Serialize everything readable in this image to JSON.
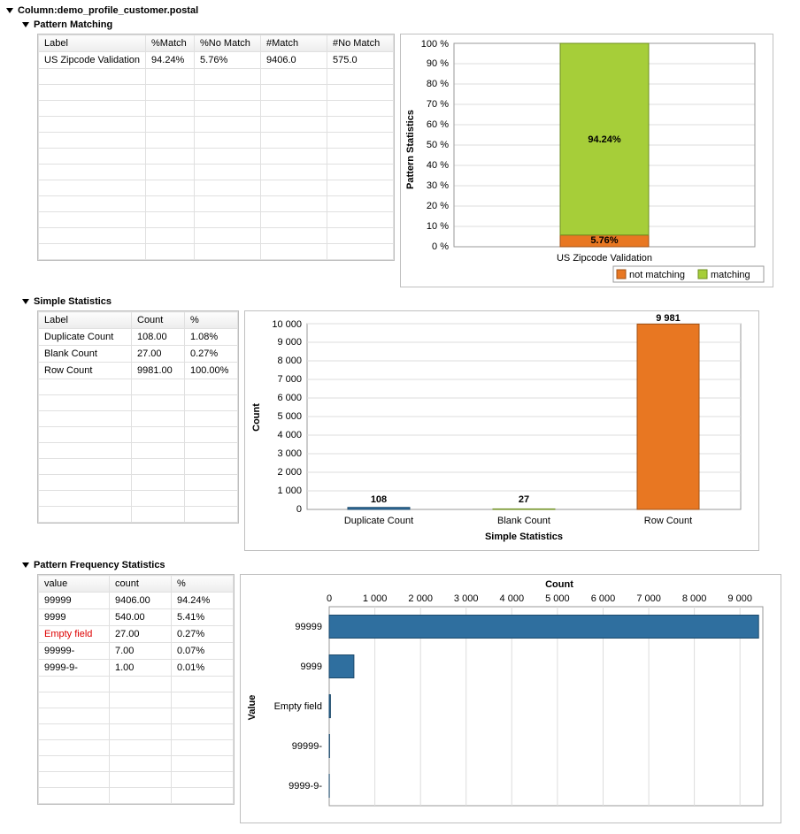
{
  "title": "Column:demo_profile_customer.postal",
  "sections": {
    "pattern_matching": {
      "title": "Pattern Matching",
      "headers": [
        "Label",
        "%Match",
        "%No Match",
        "#Match",
        "#No Match"
      ],
      "rows": [
        {
          "c0": "US Zipcode Validation",
          "c1": "94.24%",
          "c2": "5.76%",
          "c3": "9406.0",
          "c4": "575.0"
        }
      ],
      "chart_ylabel": "Pattern Statistics",
      "legend": {
        "a": "not matching",
        "b": "matching"
      },
      "match_pct_label": "94.24%",
      "nomatch_pct_label": "5.76%",
      "cat_label": "US Zipcode Validation"
    },
    "simple_stats": {
      "title": "Simple Statistics",
      "headers": [
        "Label",
        "Count",
        "%"
      ],
      "rows": [
        {
          "c0": "Duplicate Count",
          "c1": "108.00",
          "c2": "1.08%"
        },
        {
          "c0": "Blank Count",
          "c1": "27.00",
          "c2": "0.27%"
        },
        {
          "c0": "Row Count",
          "c1": "9981.00",
          "c2": "100.00%"
        }
      ],
      "chart_ylabel": "Count",
      "chart_xlabel": "Simple Statistics",
      "bar_labels": {
        "dup": "108",
        "blank": "27",
        "row": "9 981"
      },
      "cat": {
        "dup": "Duplicate Count",
        "blank": "Blank Count",
        "row": "Row Count"
      }
    },
    "freq": {
      "title": "Pattern Frequency Statistics",
      "headers": [
        "value",
        "count",
        "%"
      ],
      "rows": [
        {
          "c0": "99999",
          "c1": "9406.00",
          "c2": "94.24%",
          "red": false
        },
        {
          "c0": "9999",
          "c1": "540.00",
          "c2": "5.41%",
          "red": false
        },
        {
          "c0": "Empty field",
          "c1": "27.00",
          "c2": "0.27%",
          "red": true
        },
        {
          "c0": "99999-",
          "c1": "7.00",
          "c2": "0.07%",
          "red": false
        },
        {
          "c0": "9999-9-",
          "c1": "1.00",
          "c2": "0.01%",
          "red": false
        }
      ],
      "chart_ylabel": "Value",
      "chart_xlabel": "Count",
      "cat": {
        "v0": "99999",
        "v1": "9999",
        "v2": "Empty field",
        "v3": "99999-",
        "v4": "9999-9-"
      }
    }
  },
  "chart_data": [
    {
      "type": "bar",
      "stacked": true,
      "orientation": "vertical",
      "title": "",
      "ylabel": "Pattern Statistics",
      "xlabel": "",
      "categories": [
        "US Zipcode Validation"
      ],
      "series": [
        {
          "name": "not matching",
          "values": [
            5.76
          ],
          "color": "#e87722"
        },
        {
          "name": "matching",
          "values": [
            94.24
          ],
          "color": "#a6ce39"
        }
      ],
      "ylim": [
        0,
        100
      ],
      "yticks": [
        0,
        10,
        20,
        30,
        40,
        50,
        60,
        70,
        80,
        90,
        100
      ],
      "legend_position": "bottom",
      "grid": true,
      "data_labels": [
        "5.76%",
        "94.24%"
      ]
    },
    {
      "type": "bar",
      "orientation": "vertical",
      "title": "",
      "ylabel": "Count",
      "xlabel": "Simple Statistics",
      "categories": [
        "Duplicate Count",
        "Blank Count",
        "Row Count"
      ],
      "values": [
        108,
        27,
        9981
      ],
      "colors": [
        "#2f6f9f",
        "#a6ce39",
        "#e87722"
      ],
      "ylim": [
        0,
        10000
      ],
      "yticks": [
        0,
        1000,
        2000,
        3000,
        4000,
        5000,
        6000,
        7000,
        8000,
        9000,
        10000
      ],
      "grid": true,
      "data_labels": [
        "108",
        "27",
        "9 981"
      ]
    },
    {
      "type": "bar",
      "orientation": "horizontal",
      "title": "",
      "ylabel": "Value",
      "xlabel": "Count",
      "categories": [
        "99999",
        "9999",
        "Empty field",
        "99999-",
        "9999-9-"
      ],
      "values": [
        9406,
        540,
        27,
        7,
        1
      ],
      "color": "#2f6f9f",
      "xlim": [
        0,
        9500
      ],
      "xticks": [
        0,
        1000,
        2000,
        3000,
        4000,
        5000,
        6000,
        7000,
        8000,
        9000
      ],
      "grid": true
    }
  ]
}
